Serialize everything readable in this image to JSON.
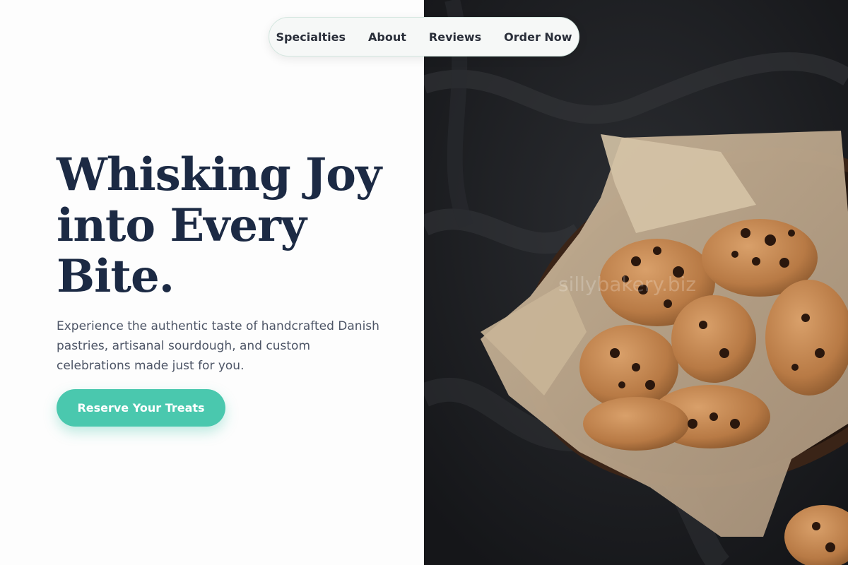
{
  "nav": {
    "items": [
      {
        "label": "Specialties"
      },
      {
        "label": "About"
      },
      {
        "label": "Reviews"
      },
      {
        "label": "Order Now"
      }
    ]
  },
  "hero": {
    "title": "Whisking Joy into Every Bite.",
    "subtitle": "Experience the authentic taste of handcrafted Danish pastries, artisanal sourdough, and custom celebrations made just for you.",
    "cta_label": "Reserve Your Treats"
  },
  "image": {
    "watermark": "sillybakery.biz",
    "description_icon": "cookies-photo"
  },
  "colors": {
    "accent": "#4ac8ae",
    "heading": "#1c2a44",
    "body_text": "#4d5566",
    "photo_background": "#1e1f22"
  }
}
